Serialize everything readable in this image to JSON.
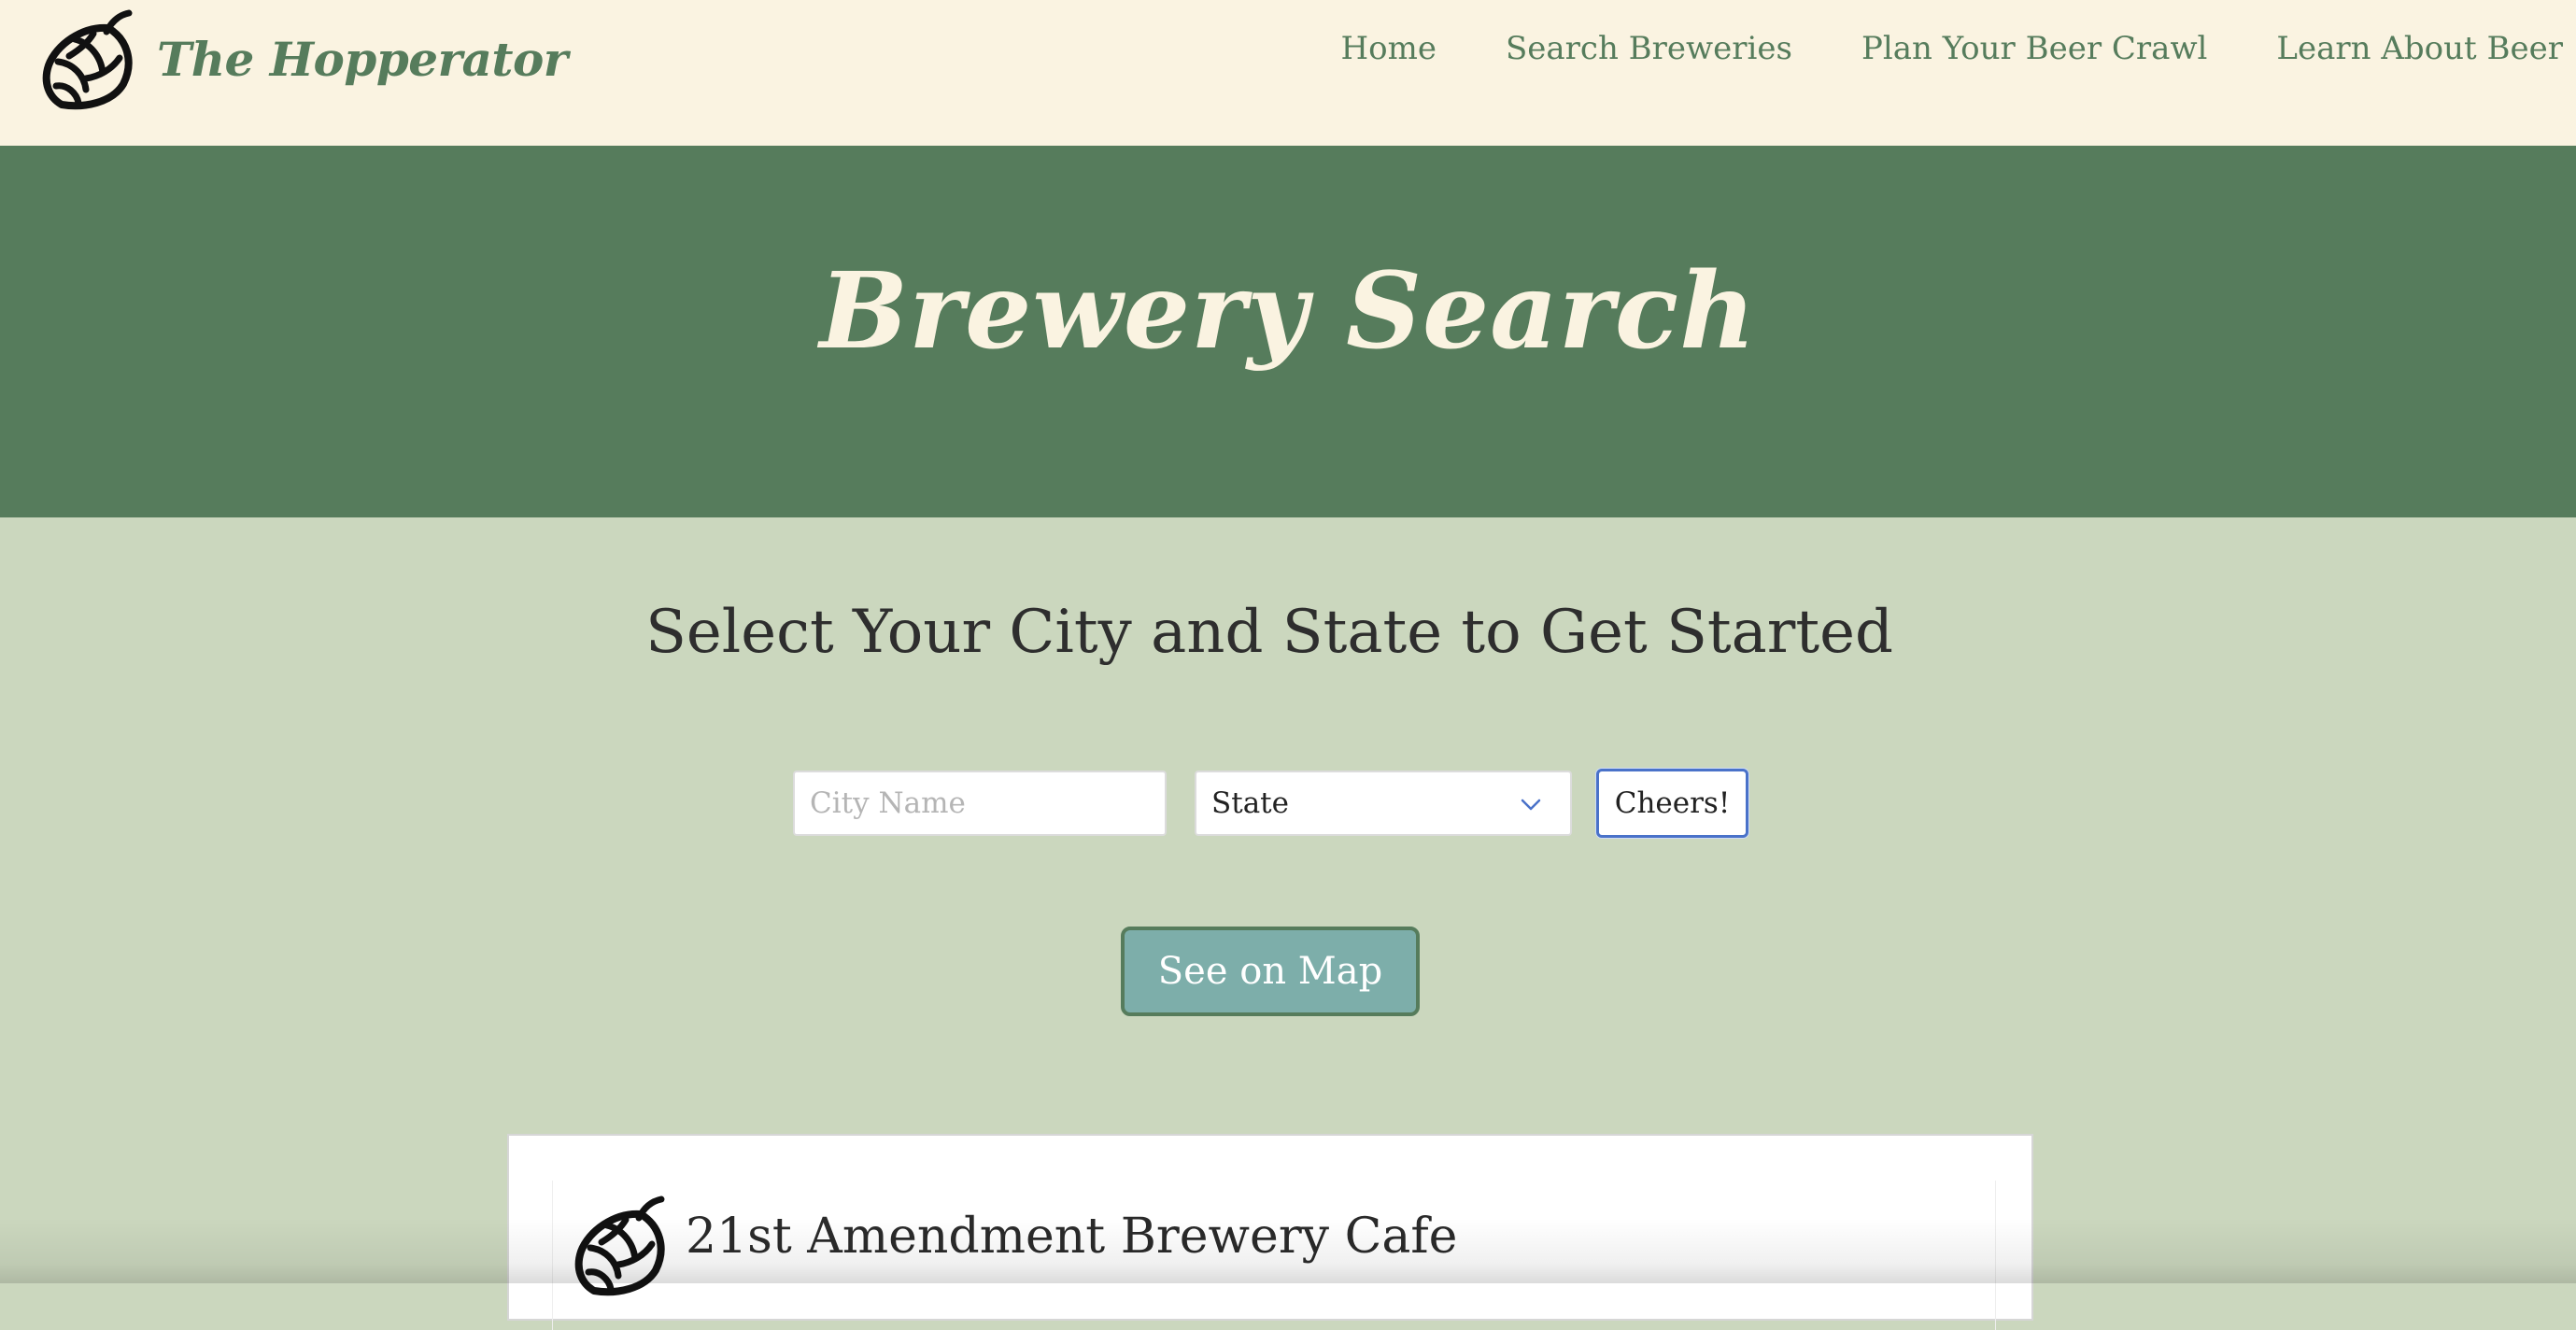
{
  "header": {
    "brand_name": "The Hopperator",
    "logo_icon": "hop-cone-icon",
    "nav": {
      "home": "Home",
      "search_breweries": "Search Breweries",
      "plan_crawl": "Plan Your Beer Crawl",
      "learn": "Learn About Beer"
    }
  },
  "hero": {
    "title": "Brewery Search"
  },
  "search": {
    "heading": "Select Your City and State to Get Started",
    "city_placeholder": "City Name",
    "city_value": "",
    "state_selected": "State",
    "submit_label": "Cheers!",
    "map_button_label": "See on Map"
  },
  "results": {
    "items": [
      {
        "name": "21st Amendment Brewery Cafe",
        "icon": "hop-cone-icon"
      }
    ]
  },
  "colors": {
    "header_bg": "#faf3e1",
    "brand_green": "#567c5c",
    "page_bg": "#cbd7be",
    "map_button_bg": "#7daeaa",
    "focus_blue": "#4a72c9"
  }
}
